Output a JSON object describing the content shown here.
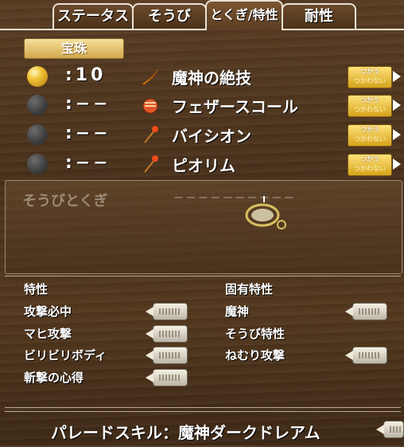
{
  "tabs": [
    {
      "label": "ステータス",
      "active": false
    },
    {
      "label": "そうび",
      "active": false
    },
    {
      "label": "とくぎ/特性",
      "active": true
    },
    {
      "label": "耐性",
      "active": false
    }
  ],
  "gems": {
    "title": "宝珠",
    "rows": [
      {
        "value": ":10",
        "state": "on",
        "skill": "魔神の絶技",
        "icon": "slash-icon",
        "use_label": "つかう",
        "nouse_label": "つかわない"
      },
      {
        "value": ":−−",
        "state": "off",
        "skill": "フェザースコール",
        "icon": "fist-icon",
        "use_label": "つかう",
        "nouse_label": "つかわない"
      },
      {
        "value": ":−−",
        "state": "off",
        "skill": "バイシオン",
        "icon": "staff-icon",
        "use_label": "つかう",
        "nouse_label": "つかわない"
      },
      {
        "value": ":−−",
        "state": "off",
        "skill": "ピオリム",
        "icon": "staff-icon",
        "use_label": "つかう",
        "nouse_label": "つかわない"
      }
    ]
  },
  "equip": {
    "title": "そうびとくぎ",
    "value": "−−−−−−−−−−"
  },
  "traits": {
    "left_title": "特性",
    "left_items": [
      "攻撃必中",
      "マヒ攻撃",
      "ビリビリボディ",
      "斬撃の心得"
    ],
    "right_title": "固有特性",
    "right_items": [
      "魔神",
      "そうび特性",
      "ねむり攻撃"
    ]
  },
  "parade": {
    "text": "パレードスキル：魔神ダークドレアム"
  },
  "colors": {
    "accent_gold": "#f2c43a",
    "wood_dark": "#4a321c"
  }
}
